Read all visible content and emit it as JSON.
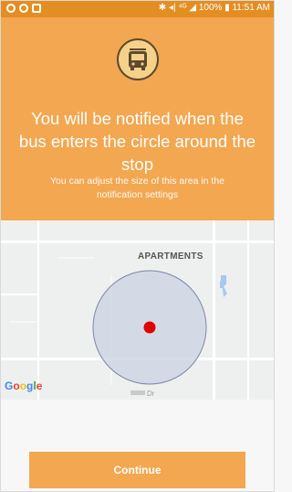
{
  "status_bar": {
    "left_icons": [
      "google-icon",
      "globe-icon",
      "image-icon"
    ],
    "right_text": "✱ ◂| ⁴ᴳ ◢ 100% ▮ 11:51 AM"
  },
  "header": {
    "icon": "bus-icon",
    "title": "You will be notified when the bus enters the circle around the stop",
    "subtitle": "You can adjust the size of this area in the notification settings"
  },
  "map": {
    "place_label": "APARTMENTS",
    "road_label": "Dr",
    "attribution": "Google",
    "colors": {
      "circle_fill": "#c9d3e3",
      "circle_stroke": "#7b86a6",
      "stop": "#e00000"
    }
  },
  "actions": {
    "continue_label": "Continue"
  },
  "colors": {
    "status_bar": "#e38e22",
    "header": "#f2a750",
    "button": "#f2a750"
  }
}
